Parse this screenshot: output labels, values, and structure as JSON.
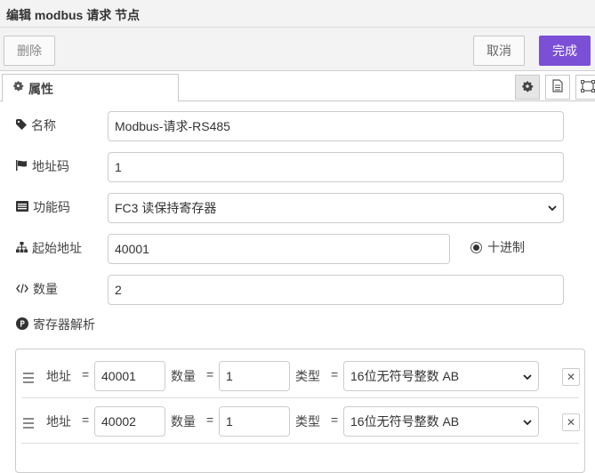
{
  "dialog": {
    "title": "编辑 modbus 请求 节点"
  },
  "toolbar": {
    "delete_label": "删除",
    "cancel_label": "取消",
    "done_label": "完成"
  },
  "tabs": {
    "properties_label": "属性"
  },
  "form": {
    "name": {
      "label": "名称",
      "value": "Modbus-请求-RS485"
    },
    "address": {
      "label": "地址码",
      "value": "1"
    },
    "function": {
      "label": "功能码",
      "value": "FC3 读保持寄存器"
    },
    "start": {
      "label": "起始地址",
      "value": "40001",
      "radio_label": "十进制"
    },
    "quantity": {
      "label": "数量",
      "value": "2"
    },
    "parse": {
      "label": "寄存器解析"
    }
  },
  "registers": {
    "col_address": "地址",
    "col_quantity": "数量",
    "col_type": "类型",
    "eq": "=",
    "rows": [
      {
        "address": "40001",
        "quantity": "1",
        "type": "16位无符号整数 AB"
      },
      {
        "address": "40002",
        "quantity": "1",
        "type": "16位无符号整数 AB"
      }
    ]
  },
  "colors": {
    "primary": "#7b4fd6"
  },
  "icons": [
    "gear-icon",
    "document-icon",
    "frame-icon",
    "tag-icon",
    "flag-icon",
    "list-icon",
    "sitemap-icon",
    "code-icon",
    "p-circle-icon",
    "drag-handle-icon",
    "close-icon",
    "chevron-down-icon"
  ]
}
